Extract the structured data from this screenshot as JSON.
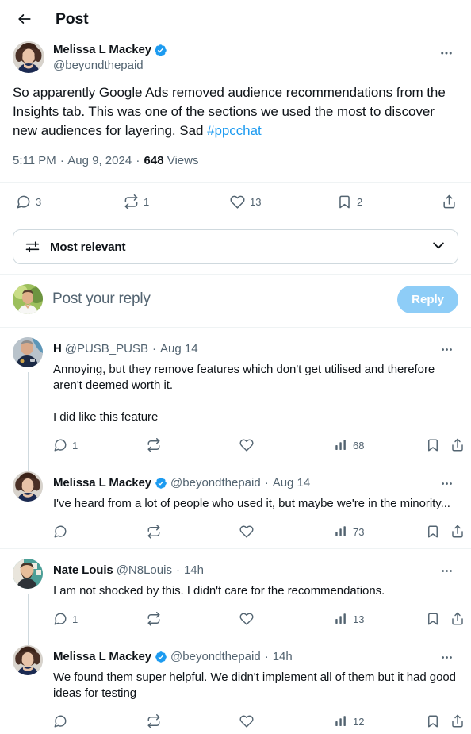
{
  "header": {
    "back_icon": "arrow-left-icon",
    "title": "Post"
  },
  "main_post": {
    "author": {
      "display_name": "Melissa L Mackey",
      "handle": "@beyondthepaid",
      "verified": true,
      "verified_color": "#1d9bf0"
    },
    "more_icon": "more-horizontal-icon",
    "text_part1": "So apparently Google Ads removed audience recommendations from the Insights tab. This was one of the sections we used the most to discover new audiences for layering. Sad ",
    "hashtag": "#ppcchat",
    "meta": {
      "time": "5:11 PM",
      "date": "Aug 9, 2024",
      "views_count": "648",
      "views_label": "Views",
      "separator": "·"
    },
    "actions": {
      "reply": {
        "icon": "reply-icon",
        "count": "3"
      },
      "retweet": {
        "icon": "retweet-icon",
        "count": "1"
      },
      "like": {
        "icon": "heart-icon",
        "count": "13"
      },
      "bookmark": {
        "icon": "bookmark-icon",
        "count": "2"
      },
      "share": {
        "icon": "share-icon",
        "count": ""
      }
    }
  },
  "sort_bar": {
    "icon": "sliders-icon",
    "label": "Most relevant",
    "chevron_icon": "chevron-down-icon"
  },
  "composer": {
    "avatar": "current-user-avatar",
    "placeholder": "Post your reply",
    "button_label": "Reply",
    "button_color": "#8ecdf7"
  },
  "replies": [
    {
      "display_name": "H",
      "handle": "@PUSB_PUSB",
      "verified": false,
      "timestamp": "Aug 14",
      "text": "Annoying, but they remove features which don't get utilised and therefore aren't deemed worth it.\n\nI did like this feature",
      "has_thread_line": true,
      "actions": {
        "reply": {
          "icon": "reply-icon",
          "count": "1"
        },
        "retweet": {
          "icon": "retweet-icon",
          "count": ""
        },
        "like": {
          "icon": "heart-icon",
          "count": ""
        },
        "views": {
          "icon": "analytics-icon",
          "count": "68"
        },
        "bookmark": {
          "icon": "bookmark-icon",
          "count": ""
        },
        "share": {
          "icon": "share-icon",
          "count": ""
        }
      }
    },
    {
      "display_name": "Melissa L Mackey",
      "handle": "@beyondthepaid",
      "verified": true,
      "timestamp": "Aug 14",
      "text": "I've heard from a lot of people who used it, but maybe we're in the minority...",
      "has_thread_line": false,
      "actions": {
        "reply": {
          "icon": "reply-icon",
          "count": ""
        },
        "retweet": {
          "icon": "retweet-icon",
          "count": ""
        },
        "like": {
          "icon": "heart-icon",
          "count": ""
        },
        "views": {
          "icon": "analytics-icon",
          "count": "73"
        },
        "bookmark": {
          "icon": "bookmark-icon",
          "count": ""
        },
        "share": {
          "icon": "share-icon",
          "count": ""
        }
      }
    },
    {
      "display_name": "Nate Louis",
      "handle": "@N8Louis",
      "verified": false,
      "timestamp": "14h",
      "text": "I am not shocked by this. I didn't care for the recommendations.",
      "has_thread_line": true,
      "actions": {
        "reply": {
          "icon": "reply-icon",
          "count": "1"
        },
        "retweet": {
          "icon": "retweet-icon",
          "count": ""
        },
        "like": {
          "icon": "heart-icon",
          "count": ""
        },
        "views": {
          "icon": "analytics-icon",
          "count": "13"
        },
        "bookmark": {
          "icon": "bookmark-icon",
          "count": ""
        },
        "share": {
          "icon": "share-icon",
          "count": ""
        }
      }
    },
    {
      "display_name": "Melissa L Mackey",
      "handle": "@beyondthepaid",
      "verified": true,
      "timestamp": "14h",
      "text": "We found them super helpful. We didn't implement all of them but it had good ideas for testing",
      "has_thread_line": false,
      "actions": {
        "reply": {
          "icon": "reply-icon",
          "count": ""
        },
        "retweet": {
          "icon": "retweet-icon",
          "count": ""
        },
        "like": {
          "icon": "heart-icon",
          "count": ""
        },
        "views": {
          "icon": "analytics-icon",
          "count": "12"
        },
        "bookmark": {
          "icon": "bookmark-icon",
          "count": ""
        },
        "share": {
          "icon": "share-icon",
          "count": ""
        }
      }
    }
  ]
}
